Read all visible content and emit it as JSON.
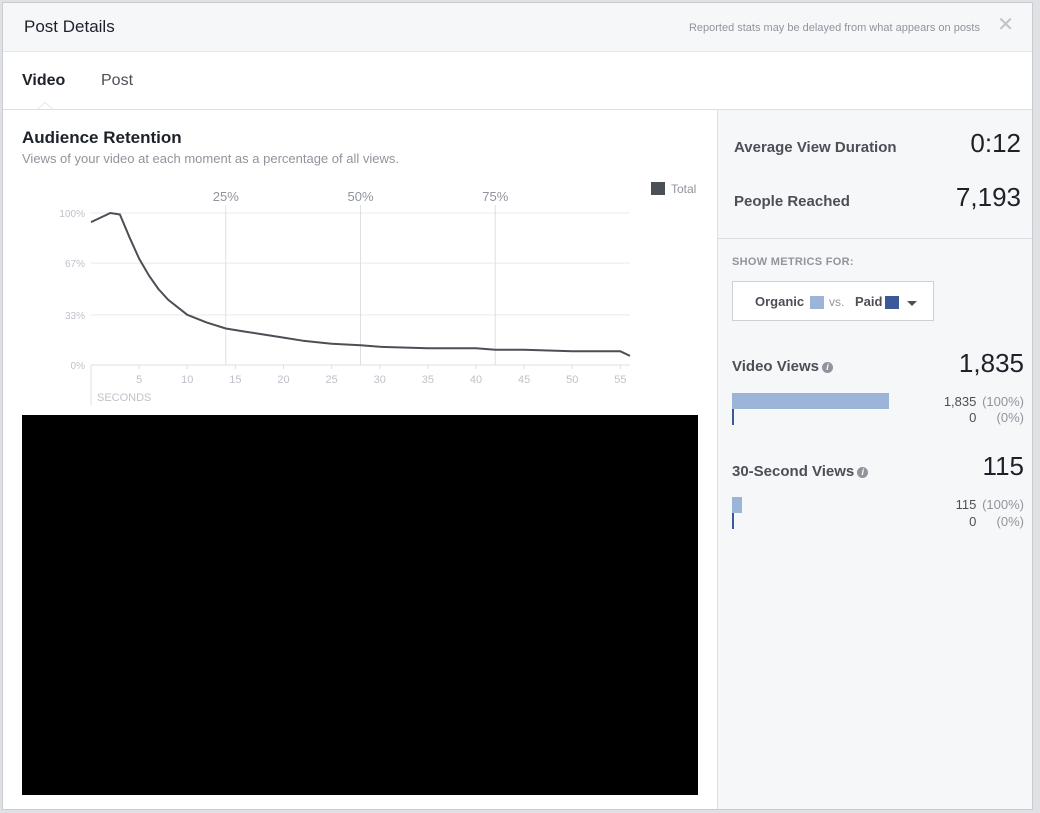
{
  "header": {
    "title": "Post Details",
    "note": "Reported stats may be delayed from what appears on posts",
    "close_glyph": "✕"
  },
  "tabs": [
    {
      "label": "Video",
      "active": true
    },
    {
      "label": "Post",
      "active": false
    }
  ],
  "retention": {
    "title": "Audience Retention",
    "subtitle": "Views of your video at each moment as a percentage of all views."
  },
  "chart_data": {
    "type": "line",
    "title": "",
    "xlabel": "SECONDS",
    "ylabel": "",
    "xlim": [
      0,
      56
    ],
    "ylim": [
      0,
      100
    ],
    "xticks": [
      5,
      10,
      15,
      20,
      25,
      30,
      35,
      40,
      45,
      50,
      55
    ],
    "yticks": [
      {
        "value": 100,
        "label": "100%"
      },
      {
        "value": 67,
        "label": "67%"
      },
      {
        "value": 33,
        "label": "33%"
      },
      {
        "value": 0,
        "label": "0%"
      }
    ],
    "markers": [
      {
        "x": 14,
        "label": "25%"
      },
      {
        "x": 28,
        "label": "50%"
      },
      {
        "x": 42,
        "label": "75%"
      }
    ],
    "legend": {
      "placement": "top-right"
    },
    "series": [
      {
        "name": "Total",
        "color": "#4b4f56",
        "x": [
          0,
          1,
          2,
          3,
          4,
          5,
          6,
          7,
          8,
          9,
          10,
          12,
          14,
          16,
          18,
          20,
          22,
          25,
          28,
          30,
          35,
          40,
          42,
          45,
          50,
          55,
          56
        ],
        "values": [
          94,
          97,
          100,
          99,
          84,
          70,
          59,
          50,
          43,
          38,
          33,
          28,
          24,
          22,
          20,
          18,
          16,
          14,
          13,
          12,
          11,
          11,
          10,
          10,
          9,
          9,
          6
        ]
      }
    ]
  },
  "stats": {
    "avg_label": "Average View Duration",
    "avg_value": "0:12",
    "reach_label": "People Reached",
    "reach_value": "7,193"
  },
  "metrics": {
    "show_label": "SHOW METRICS FOR:",
    "organic_label": "Organic",
    "vs_label": "vs.",
    "paid_label": "Paid",
    "organic_color": "#9cb4d8",
    "paid_color": "#3b5998"
  },
  "video_views": {
    "label": "Video Views",
    "value": "1,835",
    "organic_count": "1,835",
    "organic_pct": "(100%)",
    "organic_fraction": 1.0,
    "paid_count": "0",
    "paid_pct": "(0%)",
    "paid_fraction": 0.0
  },
  "thirty_sec_views": {
    "label": "30-Second Views",
    "value": "115",
    "organic_count": "115",
    "organic_pct": "(100%)",
    "organic_fraction": 0.063,
    "paid_count": "0",
    "paid_pct": "(0%)",
    "paid_fraction": 0.0
  }
}
